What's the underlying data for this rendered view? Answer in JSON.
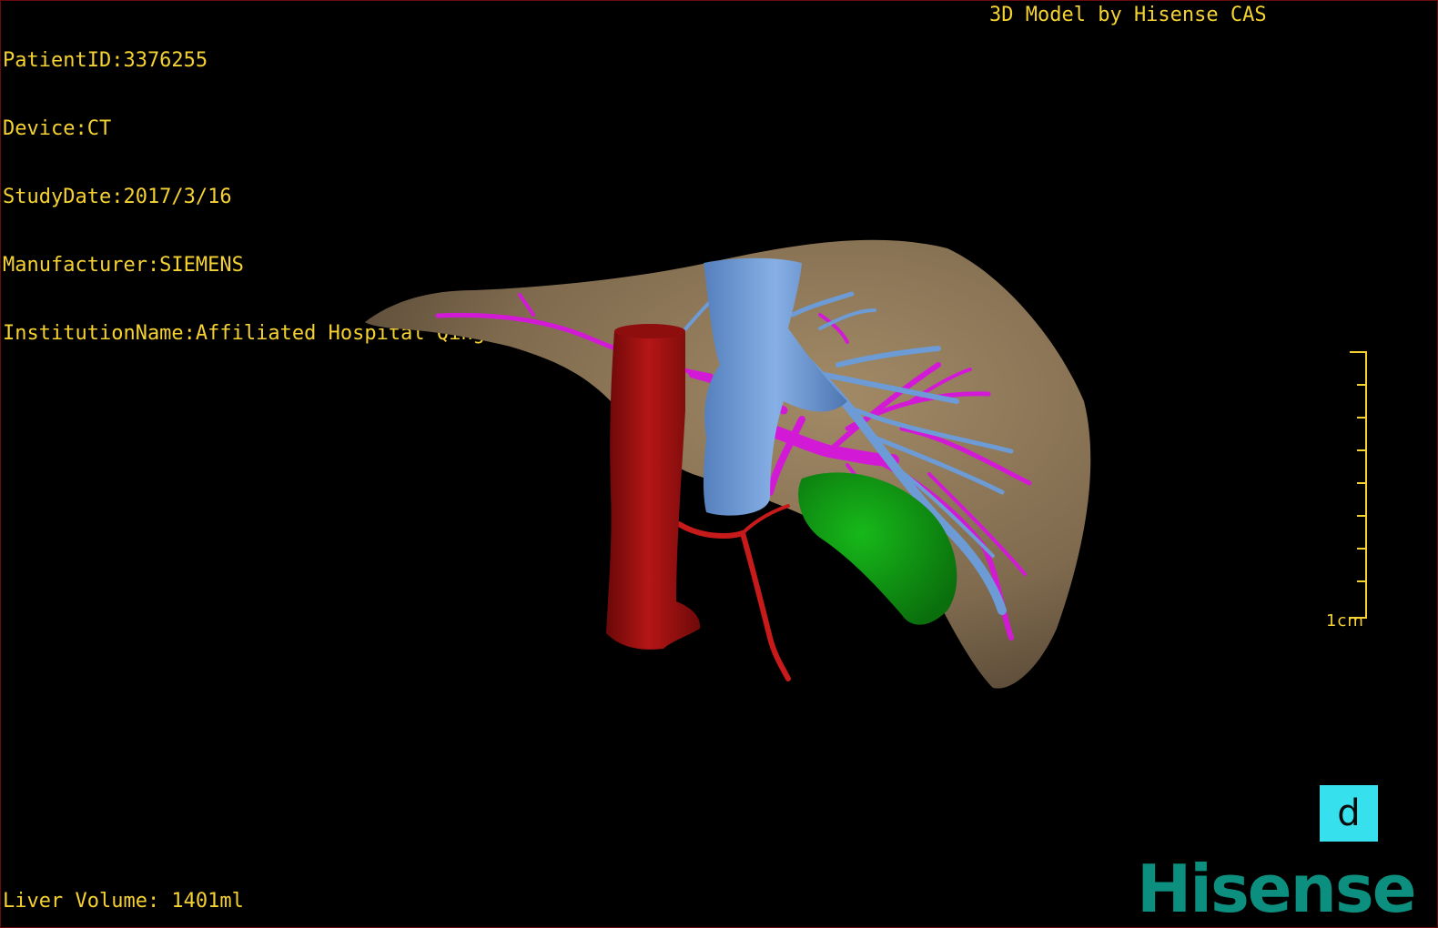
{
  "patient_info": {
    "patient_id": "PatientID:3376255",
    "device": "Device:CT",
    "study_date": "StudyDate:2017/3/16",
    "manufacturer": "Manufacturer:SIEMENS",
    "institution": "InstitutionName:Affiliated Hospital Qingdao University-C"
  },
  "model_credit": "3D Model by Hisense CAS",
  "liver_volume": "Liver Volume: 1401ml",
  "scale_bar": {
    "label": "1cm"
  },
  "view_button": {
    "label": "d"
  },
  "brand": "Hisense",
  "colors": {
    "overlay_text": "#f5d232",
    "liver": "#8b7455",
    "inferior_vena_cava": "#a81010",
    "hepatic_vein": "#6d9bd6",
    "portal_vein": "#d21ad6",
    "gallbladder": "#0f9a12",
    "artery": "#c71a1a",
    "view_button": "#36e0ec",
    "brand": "#0c8f7f"
  }
}
